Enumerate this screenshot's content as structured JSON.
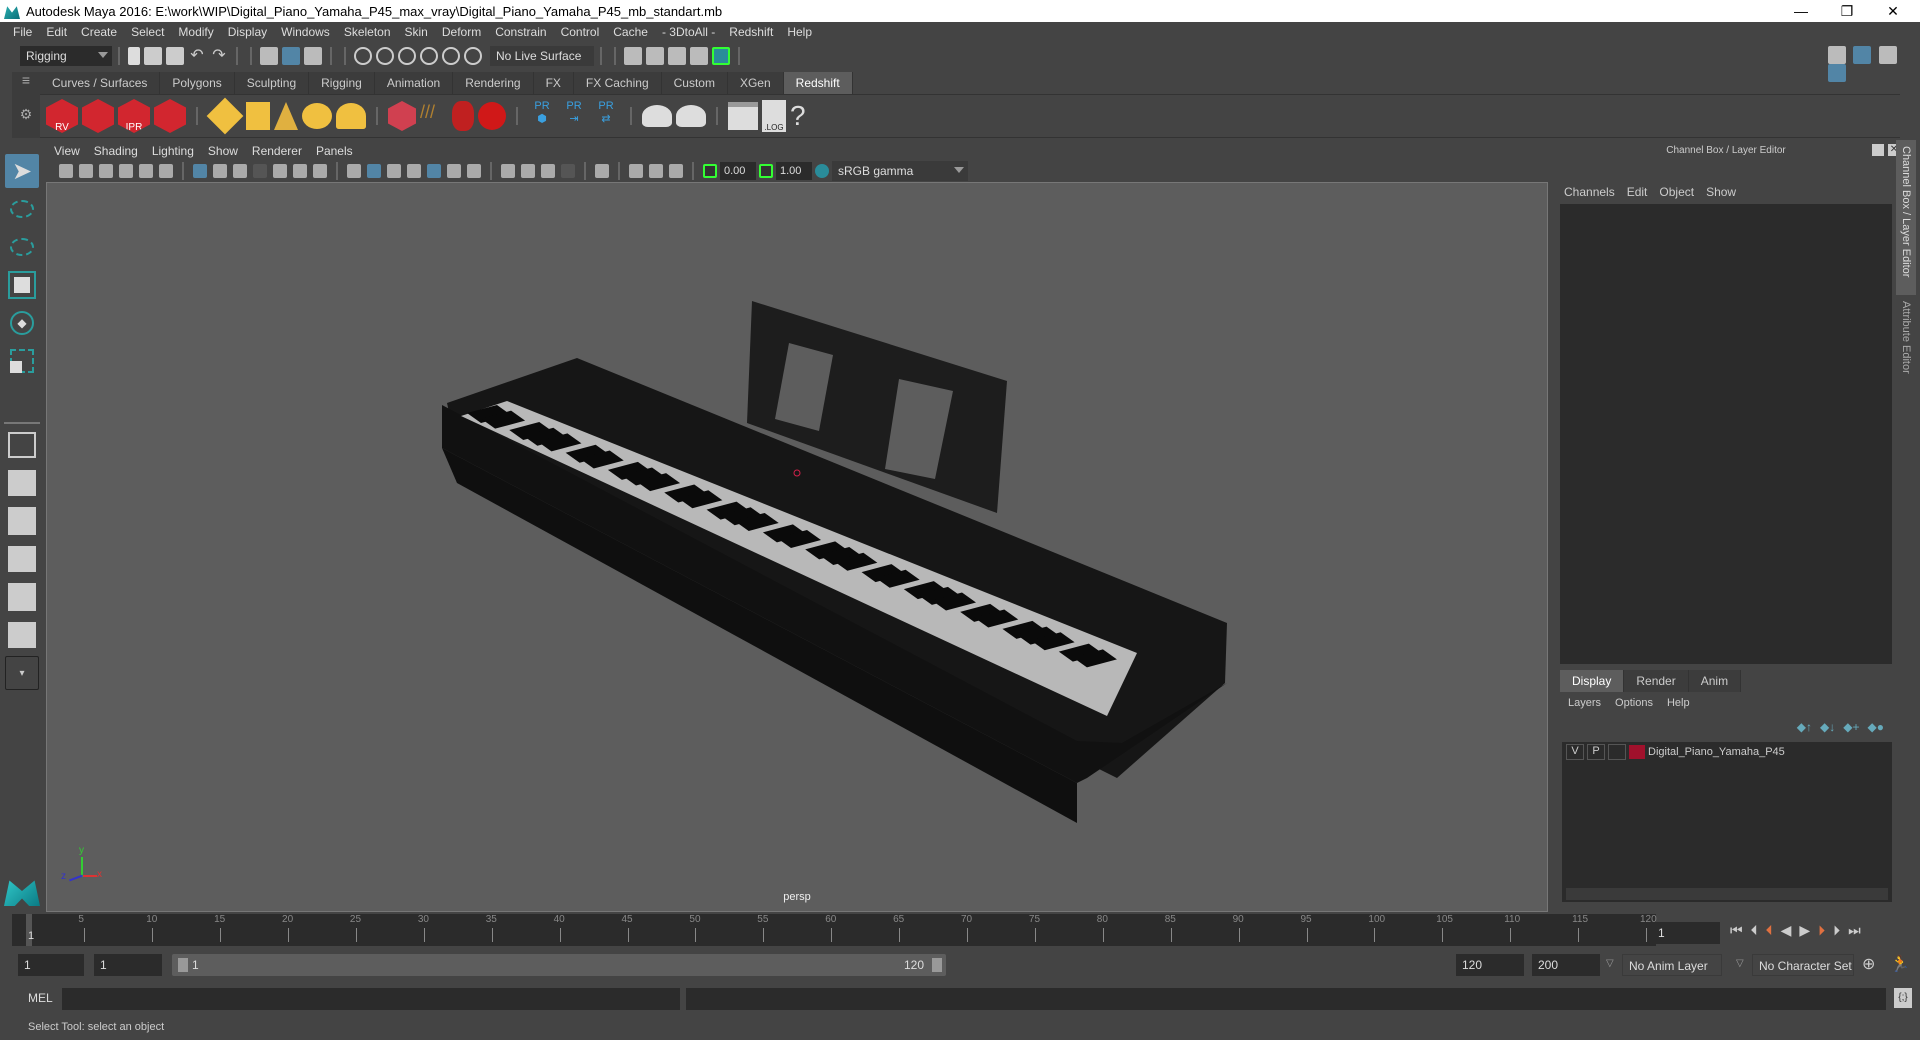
{
  "window": {
    "title": "Autodesk Maya 2016: E:\\work\\WIP\\Digital_Piano_Yamaha_P45_max_vray\\Digital_Piano_Yamaha_P45_mb_standart.mb",
    "minimize": "—",
    "restore": "❐",
    "close": "✕"
  },
  "menubar": [
    "File",
    "Edit",
    "Create",
    "Select",
    "Modify",
    "Display",
    "Windows",
    "Skeleton",
    "Skin",
    "Deform",
    "Constrain",
    "Control",
    "Cache",
    "- 3DtoAll -",
    "Redshift",
    "Help"
  ],
  "statusline": {
    "mode": "Rigging",
    "live_surface": "No Live Surface"
  },
  "shelf": {
    "tabs": [
      "Curves / Surfaces",
      "Polygons",
      "Sculpting",
      "Rigging",
      "Animation",
      "Rendering",
      "FX",
      "FX Caching",
      "Custom",
      "XGen",
      "Redshift"
    ],
    "active_tab": "Redshift",
    "icons": [
      "rs-render-view-icon",
      "rs-render-sequence-icon",
      "rs-ipr-icon",
      "rs-settings-icon",
      "rs-area-light-icon",
      "rs-portal-light-icon",
      "rs-spot-light-icon",
      "rs-dome-light-icon",
      "rs-sun-sky-icon",
      "rs-proxy-icon",
      "rs-hair-icon",
      "rs-shader-icon",
      "rs-material-icon",
      "rs-pr-object-icon",
      "rs-pr-export-icon",
      "rs-pr-swap-icon",
      "rs-bake-set-icon",
      "rs-bake-icon",
      "rs-shell-icon",
      "rs-log-icon",
      "rs-help-icon"
    ],
    "labels": {
      "rv": "RV",
      "ipr": "IPR",
      "pr": "PR",
      "log": ".LOG",
      "help": "?"
    }
  },
  "viewport": {
    "menu": [
      "View",
      "Shading",
      "Lighting",
      "Show",
      "Renderer",
      "Panels"
    ],
    "exposure": "0.00",
    "gamma": "1.00",
    "color_space": "sRGB gamma",
    "camera_label": "persp",
    "axis": {
      "x": "x",
      "y": "y",
      "z": "z"
    }
  },
  "channel_box": {
    "title": "Channel Box / Layer Editor",
    "menu": [
      "Channels",
      "Edit",
      "Object",
      "Show"
    ]
  },
  "layer_editor": {
    "tabs": [
      "Display",
      "Render",
      "Anim"
    ],
    "active_tab": "Display",
    "menu": [
      "Layers",
      "Options",
      "Help"
    ],
    "layers": [
      {
        "v": "V",
        "p": "P",
        "color": "#a0112c",
        "name": "Digital_Piano_Yamaha_P45"
      }
    ]
  },
  "side_tabs": [
    "Channel Box / Layer Editor",
    "Attribute Editor"
  ],
  "timeline": {
    "ticks": [
      "5",
      "10",
      "15",
      "20",
      "25",
      "30",
      "35",
      "40",
      "45",
      "50",
      "55",
      "60",
      "65",
      "70",
      "75",
      "80",
      "85",
      "90",
      "95",
      "100",
      "105",
      "110",
      "115",
      "120"
    ],
    "current_frame_marker": "1",
    "current_frame": "1"
  },
  "range": {
    "start": "1",
    "anim_start": "1",
    "slider_start": "1",
    "slider_end": "120",
    "end": "120",
    "anim_end": "200",
    "anim_layer": "No Anim Layer",
    "character_set": "No Character Set"
  },
  "command_line": {
    "label": "MEL"
  },
  "help_line": "Select Tool: select an object"
}
